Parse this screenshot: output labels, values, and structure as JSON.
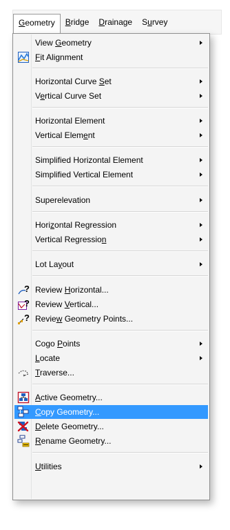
{
  "menubar": {
    "items": [
      {
        "pre": "",
        "acc": "G",
        "post": "eometry",
        "active": true
      },
      {
        "pre": "",
        "acc": "B",
        "post": "ridge",
        "active": false
      },
      {
        "pre": "",
        "acc": "D",
        "post": "rainage",
        "active": false
      },
      {
        "pre": "S",
        "acc": "u",
        "post": "rvey",
        "active": false
      }
    ]
  },
  "menu": {
    "items": [
      {
        "pre": "View ",
        "acc": "G",
        "post": "eometry",
        "submenu": true
      },
      {
        "pre": "",
        "acc": "F",
        "post": "it Alignment",
        "icon": "fit-alignment-icon"
      },
      {
        "pre": "Horizontal Curve ",
        "acc": "S",
        "post": "et",
        "submenu": true
      },
      {
        "pre": "V",
        "acc": "e",
        "post": "rtical Curve Set",
        "submenu": true
      },
      {
        "pre": "Horizontal Element",
        "acc": "",
        "post": "",
        "submenu": true
      },
      {
        "pre": "Vertical Elem",
        "acc": "e",
        "post": "nt",
        "submenu": true
      },
      {
        "pre": "Simplified Horizontal Element",
        "acc": "",
        "post": "",
        "submenu": true
      },
      {
        "pre": "Simplified Vertical Element",
        "acc": "",
        "post": "",
        "submenu": true
      },
      {
        "pre": "Superelevation",
        "acc": "",
        "post": "",
        "submenu": true
      },
      {
        "pre": "Hori",
        "acc": "z",
        "post": "ontal Regression",
        "submenu": true
      },
      {
        "pre": "Vertical Regressio",
        "acc": "n",
        "post": "",
        "submenu": true
      },
      {
        "pre": "Lot La",
        "acc": "y",
        "post": "out",
        "submenu": true
      },
      {
        "pre": "Review ",
        "acc": "H",
        "post": "orizontal...",
        "icon": "review-horizontal-icon"
      },
      {
        "pre": "Review ",
        "acc": "V",
        "post": "ertical...",
        "icon": "review-vertical-icon"
      },
      {
        "pre": "Revie",
        "acc": "w",
        "post": " Geometry Points...",
        "icon": "review-geometry-points-icon"
      },
      {
        "pre": "Cogo ",
        "acc": "P",
        "post": "oints",
        "submenu": true
      },
      {
        "pre": "",
        "acc": "L",
        "post": "ocate",
        "submenu": true
      },
      {
        "pre": "",
        "acc": "T",
        "post": "raverse...",
        "icon": "traverse-icon"
      },
      {
        "pre": "",
        "acc": "A",
        "post": "ctive Geometry...",
        "icon": "active-geometry-icon"
      },
      {
        "pre": "",
        "acc": "C",
        "post": "opy Geometry...",
        "icon": "copy-geometry-icon",
        "highlighted": true
      },
      {
        "pre": "",
        "acc": "D",
        "post": "elete Geometry...",
        "icon": "delete-geometry-icon"
      },
      {
        "pre": "",
        "acc": "R",
        "post": "ename Geometry...",
        "icon": "rename-geometry-icon"
      },
      {
        "pre": "",
        "acc": "U",
        "post": "tilities",
        "submenu": true
      }
    ]
  },
  "colors": {
    "highlight": "#3399ff",
    "menu_background": "#f4f4f4"
  }
}
